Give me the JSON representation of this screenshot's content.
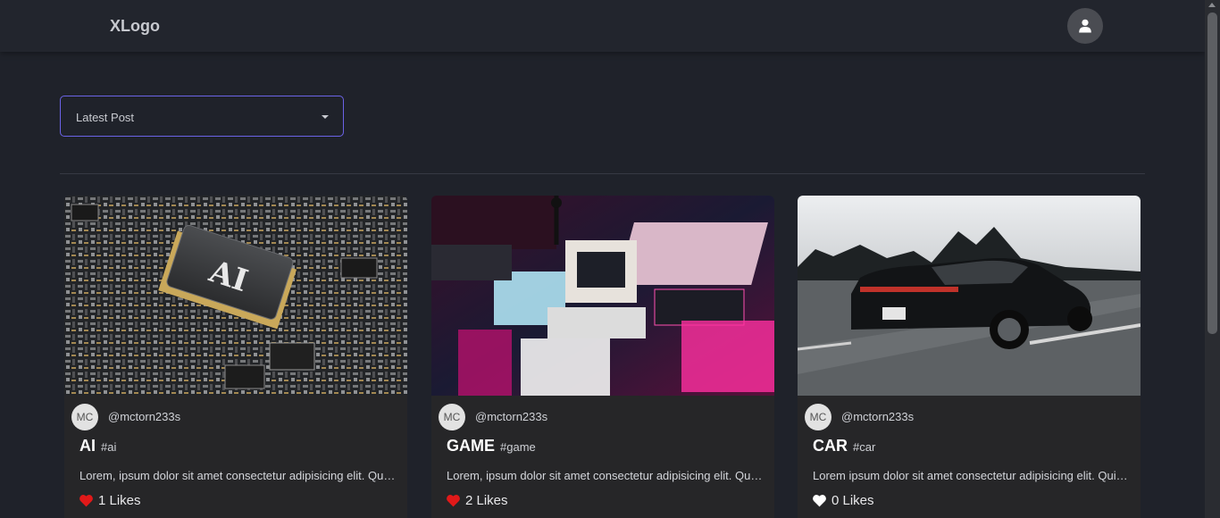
{
  "header": {
    "logo": "XLogo",
    "profile_icon": "user-icon"
  },
  "sort": {
    "selected": "Latest Post",
    "icon": "caret-down-icon",
    "accent": "#6b63e6"
  },
  "posts": [
    {
      "avatar": "MC",
      "username": "@mctorn233s",
      "title": "AI",
      "tag": "#ai",
      "description": "Lorem, ipsum dolor sit amet consectetur adipisicing elit. Quisquam, voluptatum.",
      "likes": "1 Likes",
      "liked": true,
      "image_label": "AI"
    },
    {
      "avatar": "MC",
      "username": "@mctorn233s",
      "title": "GAME",
      "tag": "#game",
      "description": "Lorem, ipsum dolor sit amet consectetur adipisicing elit. Quisquam, voluptatum.",
      "likes": "2 Likes",
      "liked": true
    },
    {
      "avatar": "MC",
      "username": "@mctorn233s",
      "title": "CAR",
      "tag": "#car",
      "description": "Lorem ipsum dolor sit amet consectetur adipisicing elit. Quisquam, voluptatum.",
      "likes": "0 Likes",
      "liked": false
    }
  ],
  "colors": {
    "liked": "#e11919",
    "unliked": "#ffffff"
  }
}
